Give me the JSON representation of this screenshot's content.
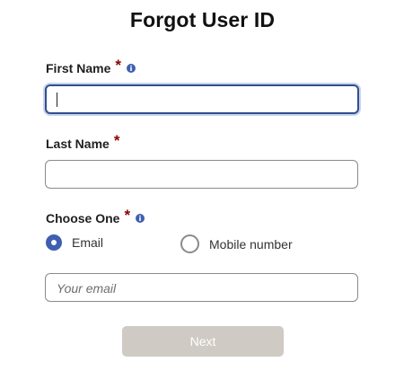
{
  "form": {
    "title": "Forgot User ID",
    "required_marker": "*",
    "first_name": {
      "label": "First Name",
      "value": ""
    },
    "last_name": {
      "label": "Last Name",
      "value": ""
    },
    "choose_one": {
      "label": "Choose One",
      "options": [
        {
          "label": "Email",
          "selected": true
        },
        {
          "label": "Mobile number",
          "selected": false
        }
      ]
    },
    "email": {
      "placeholder": "Your email",
      "value": ""
    },
    "next_label": "Next"
  },
  "icons": {
    "info": "info-icon"
  },
  "colors": {
    "required": "#8b0000",
    "accent": "#3f5fb0",
    "button_disabled": "#cfcac4"
  }
}
